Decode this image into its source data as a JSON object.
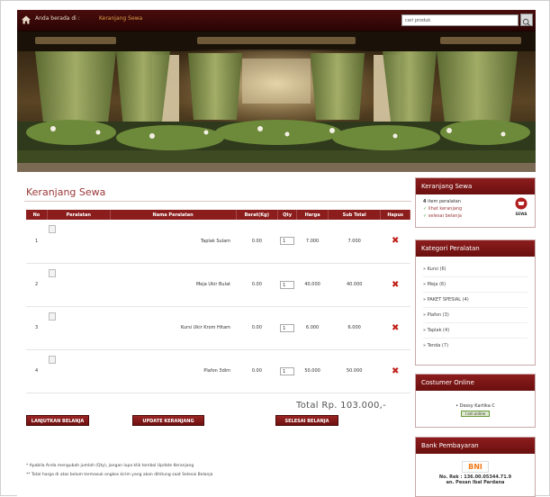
{
  "topbar": {
    "breadcrumb_prefix": "Anda berada di :",
    "breadcrumb_current": "Keranjang Sewa",
    "search_placeholder": "cari produk"
  },
  "cart": {
    "title": "Keranjang Sewa",
    "columns": [
      "No",
      "Peralatan",
      "Nama Peralatan",
      "Berat(Kg)",
      "Qty",
      "Harga",
      "Sub Total",
      "Hapus"
    ],
    "rows": [
      {
        "no": "1",
        "name": "Taplak Sulam",
        "berat": "0.00",
        "qty": "1",
        "harga": "7.000",
        "subtotal": "7.000"
      },
      {
        "no": "2",
        "name": "Meja Ukir Bulat",
        "berat": "0.00",
        "qty": "1",
        "harga": "40.000",
        "subtotal": "40.000"
      },
      {
        "no": "3",
        "name": "Kursi Ukir Krom Hitam",
        "berat": "0.00",
        "qty": "1",
        "harga": "6.000",
        "subtotal": "6.000"
      },
      {
        "no": "4",
        "name": "Plafon 3dim",
        "berat": "0.00",
        "qty": "1",
        "harga": "50.000",
        "subtotal": "50.000"
      }
    ],
    "total_label": "Total Rp. 103.000,-",
    "buttons": {
      "continue": "LANJUTKAN BELANJA",
      "update": "UPDATE KERANJANG",
      "finish": "SELESAI BELANJA"
    },
    "notes": [
      "* Apabila Anda mengubah jumlah (Qty), jangan lupa klik tombol Update Keranjang",
      "** Total harga di atas belum termasuk ongkos kirim yang akan dihitung saat Selesai Belanja"
    ]
  },
  "sidebar": {
    "cart_box": {
      "title": "Keranjang Sewa",
      "count": "4",
      "count_label": "item peralatan",
      "link_view": "lihat keranjang",
      "link_finish": "selesai belanja",
      "badge": "SEWA"
    },
    "categories": {
      "title": "Kategori Peralatan",
      "items": [
        "Kursi (6)",
        "Meja (6)",
        "PAKET SPESIAL (4)",
        "Plafon (3)",
        "Taplak (4)",
        "Tenda (7)"
      ]
    },
    "online": {
      "title": "Costumer Online",
      "name": "Dessy Kartika C",
      "status": "I am online"
    },
    "bank": {
      "title": "Bank Pembayaran",
      "logo": "BNI",
      "rek": "No. Rek : 136.00.05344.71.9",
      "an": "an. Pesan Ibal Pardana"
    }
  }
}
